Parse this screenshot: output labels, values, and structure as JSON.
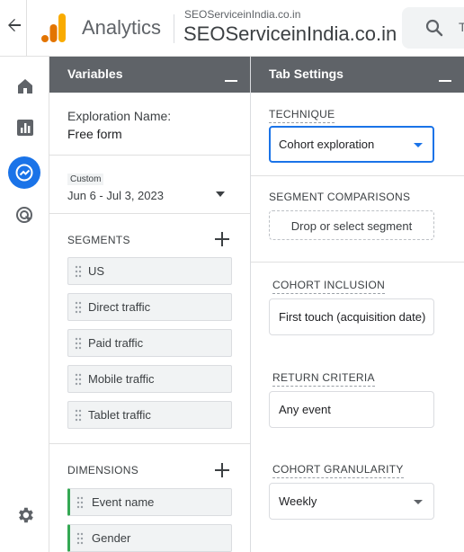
{
  "app": {
    "title": "Analytics",
    "account_small": "SEOServiceinIndia.co.in",
    "account_large": "SEOServiceinIndia.co.in",
    "search_placeholder": "T"
  },
  "colors": {
    "accent": "#1a73e8",
    "header": "#5f6368",
    "dimension_accent": "#34a853",
    "logo_orange": "#f9ab00",
    "logo_dark": "#e37400"
  },
  "nav": [
    "home-icon",
    "reports-icon",
    "explore-icon",
    "advertising-icon",
    "settings-icon"
  ],
  "variables": {
    "header": "Variables",
    "exploration_name_label": "Exploration Name:",
    "exploration_name_value": "Free form",
    "date_badge": "Custom",
    "date_range": "Jun 6 - Jul 3, 2023",
    "segments_label": "SEGMENTS",
    "segments": [
      "US",
      "Direct traffic",
      "Paid traffic",
      "Mobile traffic",
      "Tablet traffic"
    ],
    "dimensions_label": "DIMENSIONS",
    "dimensions": [
      "Event name",
      "Gender"
    ]
  },
  "tab_settings": {
    "header": "Tab Settings",
    "technique_label": "TECHNIQUE",
    "technique_value": "Cohort exploration",
    "segment_comparisons_label": "SEGMENT COMPARISONS",
    "segment_dropzone": "Drop or select segment",
    "cohort_inclusion_label": "COHORT INCLUSION",
    "cohort_inclusion_value": "First touch (acquisition date)",
    "return_criteria_label": "RETURN CRITERIA",
    "return_criteria_value": "Any event",
    "cohort_granularity_label": "COHORT GRANULARITY",
    "cohort_granularity_value": "Weekly"
  }
}
